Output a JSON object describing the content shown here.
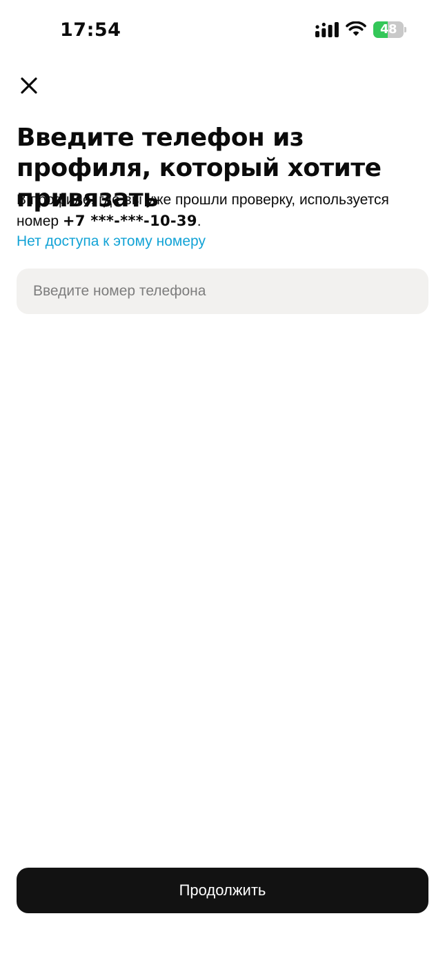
{
  "status_bar": {
    "time": "17:54",
    "battery_text": "48",
    "battery_level": 0.48,
    "signal_icon": "cellular-signal-icon",
    "wifi_icon": "wifi-icon",
    "battery_icon": "battery-charging-icon"
  },
  "header": {
    "close_icon": "close-icon"
  },
  "main": {
    "title": "Введите телефон из профиля, который хотите привязать",
    "description_prefix": "В профиле, где вы уже прошли проверку, используется номер ",
    "masked_phone": "+7 ***-***-10-39",
    "description_suffix": ".",
    "no_access_link": "Нет доступа к этому номеру",
    "phone_input": {
      "value": "",
      "placeholder": "Введите номер телефона"
    }
  },
  "footer": {
    "continue_label": "Продолжить"
  },
  "colors": {
    "link": "#13a3d6",
    "input_bg": "#f2f1ef",
    "button_bg": "#121212",
    "battery_fill": "#34c759"
  }
}
